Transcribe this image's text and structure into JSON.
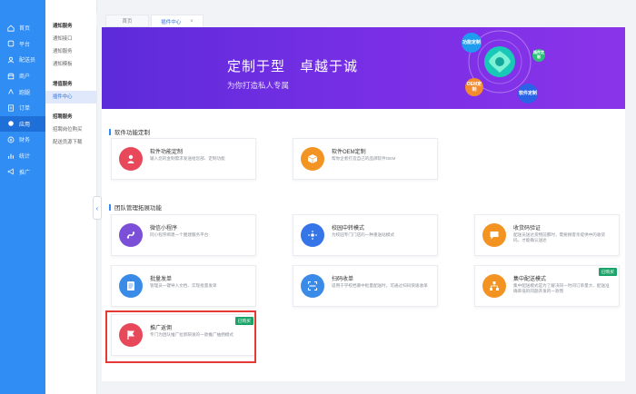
{
  "sidebar": {
    "items": [
      {
        "label": "首页",
        "icon": "home-icon"
      },
      {
        "label": "平台",
        "icon": "platform-icon"
      },
      {
        "label": "配送员",
        "icon": "courier-icon"
      },
      {
        "label": "商户",
        "icon": "merchant-icon"
      },
      {
        "label": "跑腿",
        "icon": "errand-icon"
      },
      {
        "label": "订单",
        "icon": "order-icon"
      },
      {
        "label": "应用",
        "icon": "app-icon",
        "active": true
      },
      {
        "label": "财务",
        "icon": "finance-icon"
      },
      {
        "label": "统计",
        "icon": "stats-icon"
      },
      {
        "label": "推广",
        "icon": "promote-icon"
      }
    ]
  },
  "submenu": {
    "groups": [
      {
        "title": "通知服务",
        "items": [
          "通知接口",
          "通知服务",
          "通知模板"
        ]
      },
      {
        "title": "增值服务",
        "items": [
          "插件中心"
        ]
      },
      {
        "title": "招聘服务",
        "items": [
          "招聘岗位购买",
          "配送员源下载"
        ]
      }
    ],
    "active_item": "插件中心"
  },
  "tabs": [
    {
      "label": "首页"
    },
    {
      "label": "插件中心",
      "close": "×"
    }
  ],
  "banner": {
    "title": "定制于型　卓越于诚",
    "subtitle": "为你打造私人专属",
    "bubbles": [
      "功能定制",
      "插件定制",
      "OEM定制",
      "软件定制"
    ]
  },
  "sections": [
    {
      "title": "软件功能定制",
      "cards": [
        {
          "title": "软件功能定制",
          "desc": "输入您的金制需求发送给您部、定制功能",
          "icon": "wrench-icon",
          "color": "#e8495a",
          "purchased": ""
        },
        {
          "title": "软件OEM定制",
          "desc": "帮你企者打造自己的品牌软件OEM",
          "icon": "box-icon",
          "color": "#f39322",
          "purchased": ""
        }
      ]
    },
    {
      "title": "团队管理拓展功能",
      "cards": [
        {
          "title": "微信小程序",
          "desc": "同小程序绑建一个圈建服务平台",
          "icon": "miniprogram-icon",
          "color": "#7b4fd8",
          "purchased": ""
        },
        {
          "title": "校园中转模式",
          "desc": "为校园专门门店的一种重送站模式",
          "icon": "transfer-icon",
          "color": "#3575e8",
          "purchased": ""
        },
        {
          "title": "收货码验证",
          "desc": "配送员送达货物前都时，需要顾客亲提供中的收货码，才能确认送达",
          "icon": "message-icon",
          "color": "#f39322",
          "purchased": ""
        },
        {
          "title": "批量发单",
          "desc": "管理员一键导入文档、实现批量发单",
          "icon": "list-icon",
          "color": "#3a8be8",
          "purchased": ""
        },
        {
          "title": "扫码收单",
          "desc": "适用于学校档暴中批量配送时，可通过扫码快速收单",
          "icon": "scan-icon",
          "color": "#3a8be8",
          "purchased": ""
        },
        {
          "title": "集中配送模式",
          "desc": "集中配送模式是为了解决同一时间订单量大、配送准确率低的同题开发的一款而",
          "icon": "network-icon",
          "color": "#f39322",
          "purchased": "已购买"
        },
        {
          "title": "推广返佣",
          "desc": "专门为团队推广拉新研发的一款推广抽佣模式",
          "icon": "flag-icon",
          "color": "#e8495a",
          "purchased": "已购买"
        }
      ]
    }
  ]
}
